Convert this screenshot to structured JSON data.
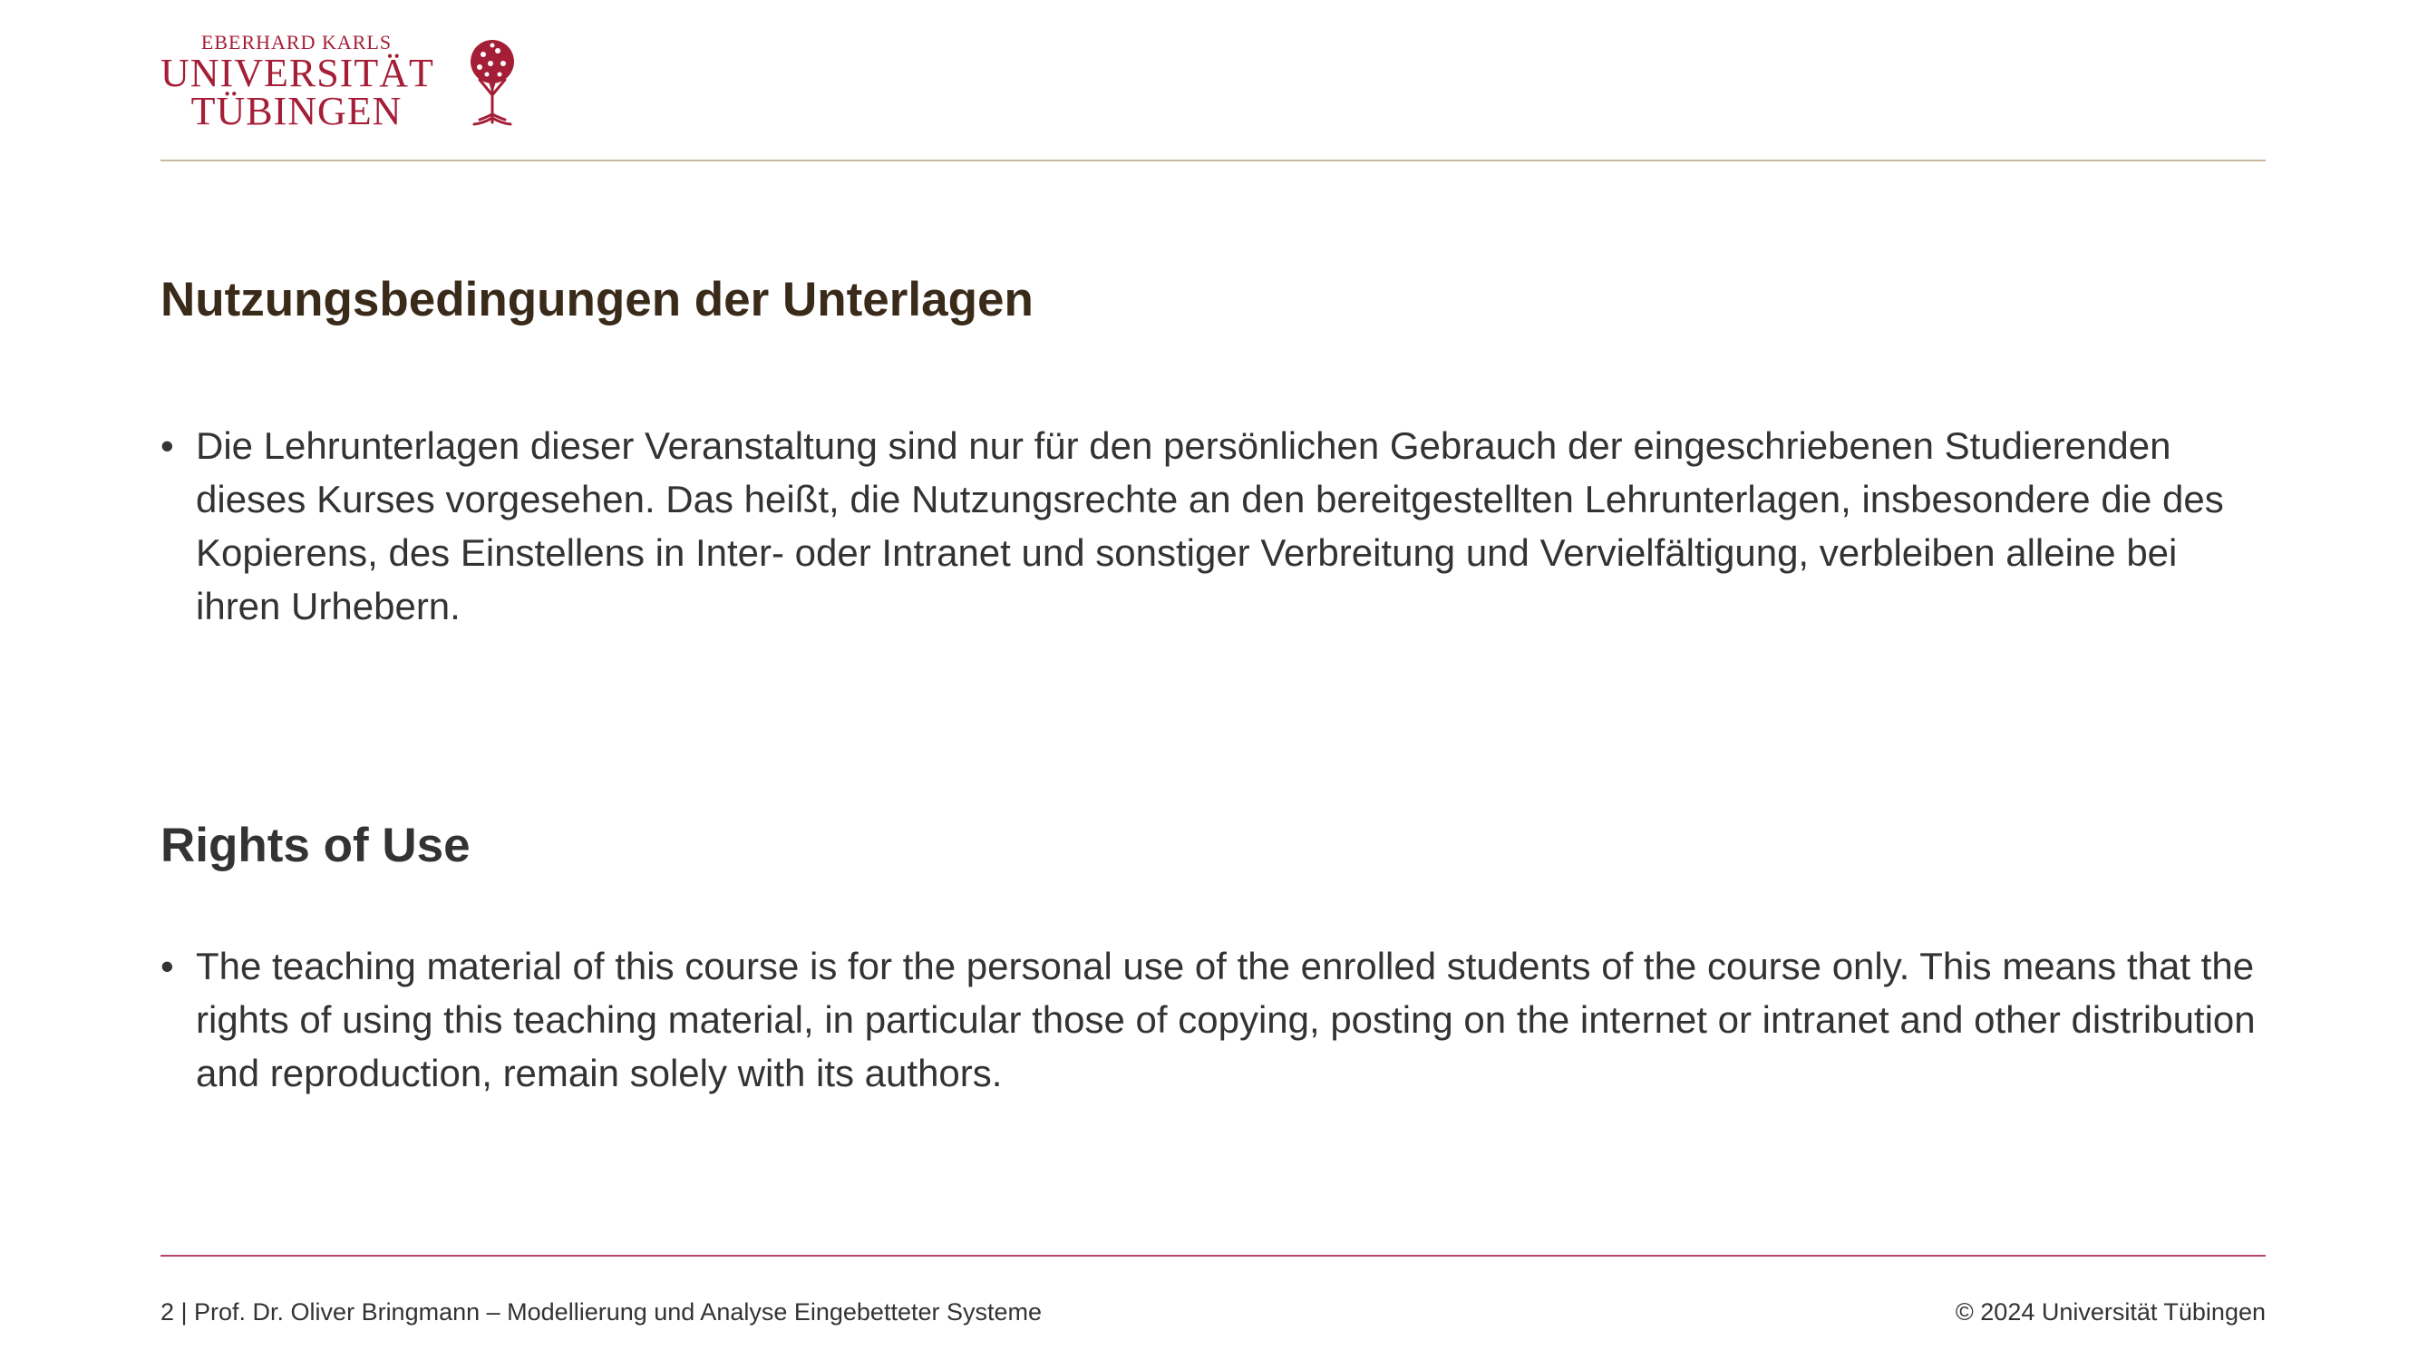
{
  "logo": {
    "line1": "EBERHARD KARLS",
    "line2": "UNIVERSITÄT",
    "line3": "TÜBINGEN",
    "icon": "tree-icon",
    "color": "#a51e37"
  },
  "section_de": {
    "title": "Nutzungsbedingungen der Unterlagen",
    "bullet_mark": "•",
    "text": "Die Lehrunterlagen dieser Veranstaltung sind nur für den persönlichen Gebrauch der eingeschriebenen Studierenden dieses Kurses vorgesehen. Das heißt, die Nutzungsrechte an den bereitgestellten Lehrunterlagen, insbesondere die des Kopierens, des Einstellens in Inter- oder Intranet und sonstiger Verbreitung und Vervielfältigung, verbleiben alleine bei ihren Urhebern."
  },
  "section_en": {
    "title": "Rights of Use",
    "bullet_mark": "•",
    "text": "The teaching material of this course is for the personal use of the enrolled students of the course only. This means that the rights of using this teaching material, in particular those of copying, posting on the internet or intranet and other distribution and reproduction, remain solely with its authors."
  },
  "footer": {
    "left": "2 | Prof. Dr. Oliver Bringmann – Modellierung und Analyse Eingebetteter Systeme",
    "right": "© 2024 Universität Tübingen"
  },
  "colors": {
    "top_rule": "#c9b79c",
    "bottom_rule": "#b5466b"
  }
}
